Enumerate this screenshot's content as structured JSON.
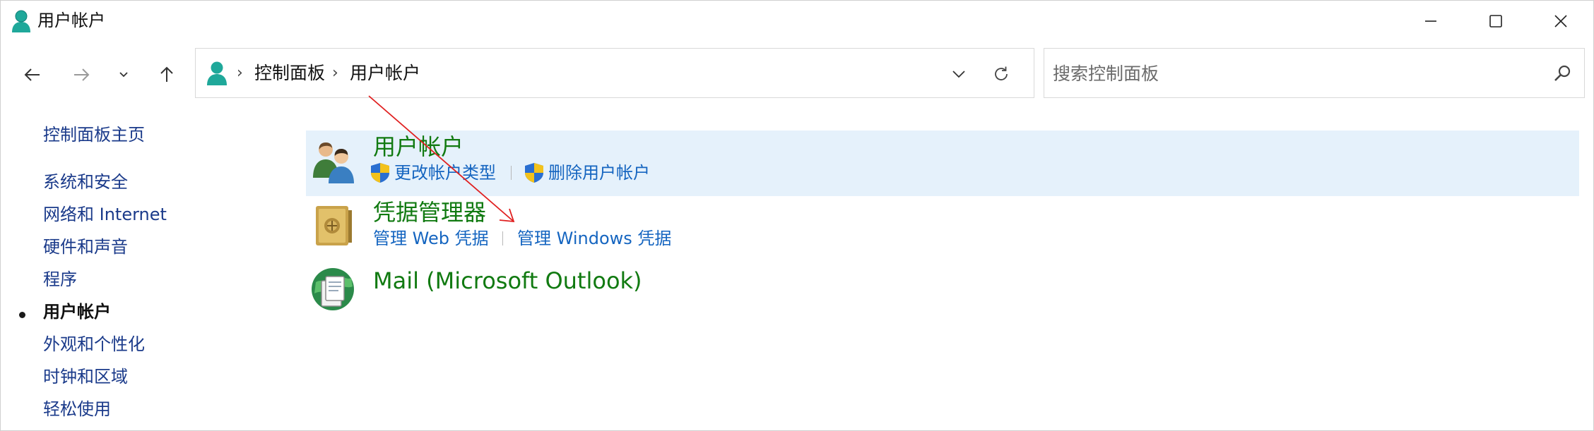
{
  "window": {
    "title": "用户帐户"
  },
  "address": {
    "crumbs": [
      "控制面板",
      "用户帐户"
    ]
  },
  "search": {
    "placeholder": "搜索控制面板"
  },
  "sidebar": {
    "home": "控制面板主页",
    "items": [
      {
        "label": "系统和安全",
        "active": false
      },
      {
        "label": "网络和 Internet",
        "active": false
      },
      {
        "label": "硬件和声音",
        "active": false
      },
      {
        "label": "程序",
        "active": false
      },
      {
        "label": "用户帐户",
        "active": true
      },
      {
        "label": "外观和个性化",
        "active": false
      },
      {
        "label": "时钟和区域",
        "active": false
      },
      {
        "label": "轻松使用",
        "active": false
      }
    ]
  },
  "categories": [
    {
      "title": "用户帐户",
      "icon": "users-icon",
      "links": [
        "更改帐户类型",
        "删除用户帐户"
      ]
    },
    {
      "title": "凭据管理器",
      "icon": "vault-icon",
      "links": [
        "管理 Web 凭据",
        "管理 Windows 凭据"
      ]
    },
    {
      "title": "Mail (Microsoft Outlook)",
      "icon": "mail-icon",
      "links": []
    }
  ],
  "colors": {
    "category_title": "#117a11",
    "link": "#1565c0",
    "highlight": "#e5f1fb",
    "annotation_arrow": "#e02020"
  }
}
